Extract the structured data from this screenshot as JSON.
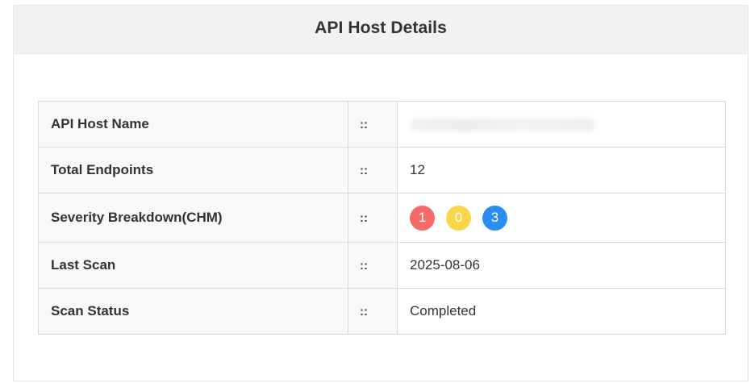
{
  "card": {
    "title": "API Host Details"
  },
  "details": {
    "separator": "::",
    "rows": [
      {
        "label": "API Host Name",
        "value": ""
      },
      {
        "label": "Total Endpoints",
        "value": "12"
      },
      {
        "label": "Severity Breakdown(CHM)",
        "value": ""
      },
      {
        "label": "Last Scan",
        "value": "2025-08-06"
      },
      {
        "label": "Scan Status",
        "value": "Completed"
      }
    ],
    "severity": {
      "critical": {
        "count": "1",
        "color": "#f86a6a"
      },
      "high": {
        "count": "0",
        "color": "#fcd54a"
      },
      "medium": {
        "count": "3",
        "color": "#2b8cf2"
      }
    }
  }
}
